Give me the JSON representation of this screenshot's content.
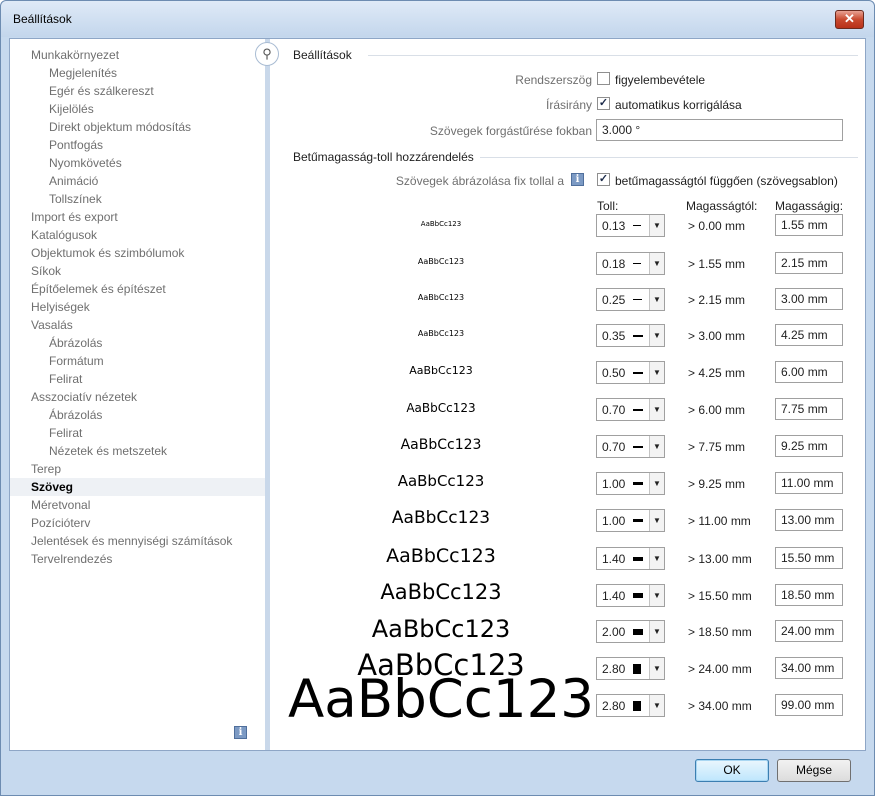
{
  "window": {
    "title": "Beállítások",
    "close_glyph": "✕"
  },
  "sidebar": {
    "items": [
      {
        "label": "Munkakörnyezet",
        "level": 0
      },
      {
        "label": "Megjelenítés",
        "level": 1
      },
      {
        "label": "Egér és szálkereszt",
        "level": 1
      },
      {
        "label": "Kijelölés",
        "level": 1
      },
      {
        "label": "Direkt objektum módosítás",
        "level": 1
      },
      {
        "label": "Pontfogás",
        "level": 1
      },
      {
        "label": "Nyomkövetés",
        "level": 1
      },
      {
        "label": "Animáció",
        "level": 1
      },
      {
        "label": "Tollszínek",
        "level": 1
      },
      {
        "label": "Import és export",
        "level": 0
      },
      {
        "label": "Katalógusok",
        "level": 0
      },
      {
        "label": "Objektumok és szimbólumok",
        "level": 0
      },
      {
        "label": "Síkok",
        "level": 0
      },
      {
        "label": "Építőelemek és építészet",
        "level": 0
      },
      {
        "label": "Helyiségek",
        "level": 0
      },
      {
        "label": "Vasalás",
        "level": 0
      },
      {
        "label": "Ábrázolás",
        "level": 1
      },
      {
        "label": "Formátum",
        "level": 1
      },
      {
        "label": "Felirat",
        "level": 1
      },
      {
        "label": "Asszociatív nézetek",
        "level": 0
      },
      {
        "label": "Ábrázolás",
        "level": 1
      },
      {
        "label": "Felirat",
        "level": 1
      },
      {
        "label": "Nézetek és metszetek",
        "level": 1
      },
      {
        "label": "Terep",
        "level": 0
      },
      {
        "label": "Szöveg",
        "level": 0,
        "selected": true
      },
      {
        "label": "Méretvonal",
        "level": 0
      },
      {
        "label": "Pozícióterv",
        "level": 0
      },
      {
        "label": "Jelentések és mennyiségi számítások",
        "level": 0
      },
      {
        "label": "Tervelrendezés",
        "level": 0
      }
    ],
    "info_icon": "info-icon",
    "info_glyph": "i"
  },
  "search": {
    "icon": "search-icon",
    "glyph": "⚲"
  },
  "settings": {
    "section_title": "Beállítások",
    "rendszerszog_label": "Rendszerszög",
    "rendszerszog_checkbox": "figyelembevétele",
    "rendszerszog_checked": false,
    "irasirany_label": "Írásirány",
    "irasirany_checkbox": "automatikus korrigálása",
    "irasirany_checked": true,
    "fokban_label": "Szövegek forgástűrése fokban",
    "fokban_value": "3.000 °"
  },
  "pen": {
    "section_title": "Betűmagasság-toll hozzárendelés",
    "fix_label": "Szövegek ábrázolása fix tollal a",
    "fix_checkbox": "betűmagasságtól függően (szövegsablon)",
    "fix_checked": true,
    "info_glyph": "i",
    "col_pen": "Toll:",
    "col_from": "Magasságtól:",
    "col_to": "Magasságig:",
    "check_glyph": "✓",
    "arrow_glyph": "▼",
    "sample_text": "AaBbCc123",
    "rows": [
      {
        "pen": "0.13",
        "from": "> 0.00 mm",
        "to": "1.55 mm"
      },
      {
        "pen": "0.18",
        "from": "> 1.55 mm",
        "to": "2.15 mm"
      },
      {
        "pen": "0.25",
        "from": "> 2.15 mm",
        "to": "3.00 mm"
      },
      {
        "pen": "0.35",
        "from": "> 3.00 mm",
        "to": "4.25 mm"
      },
      {
        "pen": "0.50",
        "from": "> 4.25 mm",
        "to": "6.00 mm"
      },
      {
        "pen": "0.70",
        "from": "> 6.00 mm",
        "to": "7.75 mm"
      },
      {
        "pen": "0.70",
        "from": "> 7.75 mm",
        "to": "9.25 mm"
      },
      {
        "pen": "1.00",
        "from": "> 9.25 mm",
        "to": "11.00 mm"
      },
      {
        "pen": "1.00",
        "from": "> 11.00 mm",
        "to": "13.00 mm"
      },
      {
        "pen": "1.40",
        "from": "> 13.00 mm",
        "to": "15.50 mm"
      },
      {
        "pen": "1.40",
        "from": "> 15.50 mm",
        "to": "18.50 mm"
      },
      {
        "pen": "2.00",
        "from": "> 18.50 mm",
        "to": "24.00 mm"
      },
      {
        "pen": "2.80",
        "from": "> 24.00 mm",
        "to": "34.00 mm"
      },
      {
        "pen": "2.80",
        "from": "> 34.00 mm",
        "to": "99.00 mm"
      }
    ]
  },
  "buttons": {
    "ok": "OK",
    "cancel": "Mégse"
  }
}
